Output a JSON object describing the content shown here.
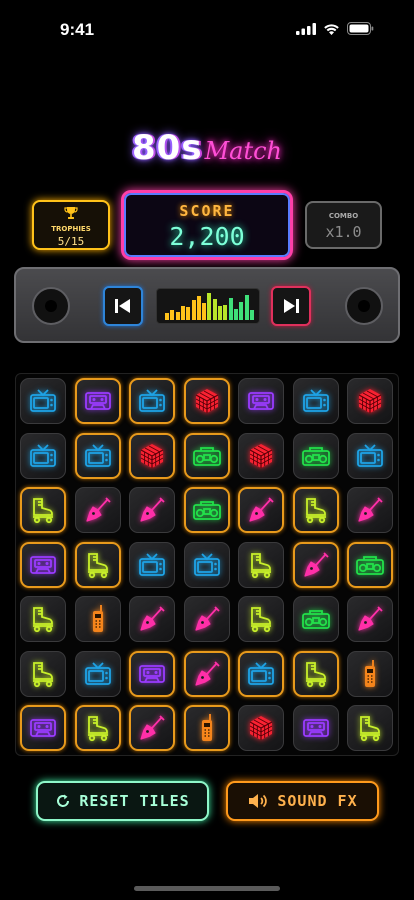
{
  "status_bar": {
    "time": "9:41"
  },
  "logo": {
    "main": "80s",
    "script": "Match"
  },
  "trophies": {
    "label": "TROPHIES",
    "value": "5/15",
    "icon": "trophy-icon",
    "color": "#ffc21a"
  },
  "score": {
    "label": "SCORE",
    "value": "2,200"
  },
  "combo": {
    "label": "COMBO",
    "value": "x1.0"
  },
  "player": {
    "prev_icon": "skip-back-icon",
    "next_icon": "skip-forward-icon",
    "equalizer_levels": [
      0.25,
      0.35,
      0.3,
      0.5,
      0.45,
      0.7,
      0.85,
      0.6,
      0.95,
      0.75,
      0.5,
      0.55,
      0.8,
      0.4,
      0.65,
      0.9,
      0.35
    ]
  },
  "board": {
    "cols": 7,
    "rows": 7,
    "tiles": [
      [
        "tv",
        "cassette",
        "tv",
        "cube",
        "cassette",
        "tv",
        "cube"
      ],
      [
        "tv",
        "tv",
        "cube",
        "boombox",
        "cube",
        "boombox",
        "tv"
      ],
      [
        "skate",
        "guitar",
        "guitar",
        "boombox",
        "guitar",
        "skate",
        "guitar"
      ],
      [
        "cassette",
        "skate",
        "tv",
        "tv",
        "skate",
        "guitar",
        "boombox"
      ],
      [
        "skate",
        "phone",
        "guitar",
        "guitar",
        "skate",
        "boombox",
        "guitar"
      ],
      [
        "skate",
        "tv",
        "cassette",
        "guitar",
        "tv",
        "skate",
        "phone"
      ],
      [
        "cassette",
        "skate",
        "guitar",
        "phone",
        "cube",
        "cassette",
        "skate"
      ]
    ],
    "selected": [
      [
        0,
        0,
        0,
        0,
        0,
        0,
        0
      ],
      [
        0,
        1,
        0,
        1,
        0,
        0,
        0
      ],
      [
        1,
        0,
        0,
        1,
        1,
        1,
        0
      ],
      [
        1,
        1,
        0,
        0,
        0,
        1,
        1
      ],
      [
        0,
        0,
        0,
        0,
        0,
        0,
        0
      ],
      [
        0,
        0,
        1,
        1,
        1,
        1,
        0
      ],
      [
        1,
        1,
        1,
        1,
        0,
        0,
        0
      ]
    ],
    "selected_row0": [
      0,
      1,
      1,
      1,
      0,
      0,
      0
    ],
    "selected_row1_extra": [
      0,
      1,
      1,
      1,
      0,
      0,
      0
    ]
  },
  "icon_colors": {
    "tv": "#1ea3e6",
    "cassette": "#9a3bff",
    "cube": "#ff2233",
    "boombox": "#22e04a",
    "skate": "#c8f02a",
    "guitar": "#ff2fa8",
    "phone": "#ff8a1c"
  },
  "buttons": {
    "reset": "RESET TILES",
    "sound": "SOUND FX"
  }
}
